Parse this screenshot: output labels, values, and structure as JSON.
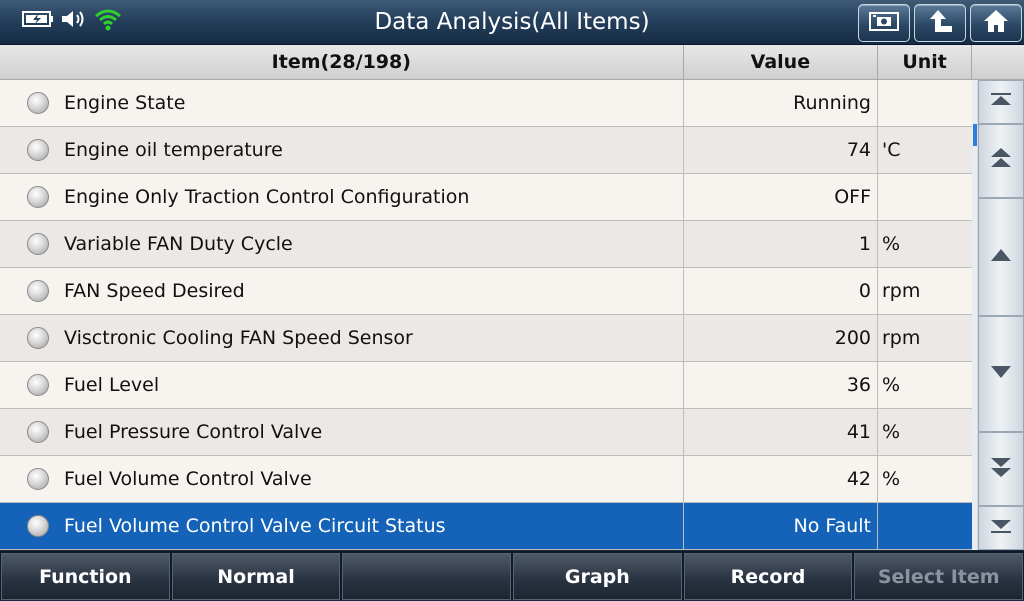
{
  "window": {
    "title": "Data Analysis(All Items)"
  },
  "status": {
    "battery_icon": "battery-charging-icon",
    "volume_icon": "volume-icon",
    "wifi_icon": "wifi-icon",
    "wifi_color": "#2fd12f"
  },
  "top_buttons": [
    {
      "name": "screenshot-icon"
    },
    {
      "name": "back-icon"
    },
    {
      "name": "home-icon"
    }
  ],
  "table": {
    "headers": {
      "item": "Item(28/198)",
      "value": "Value",
      "unit": "Unit"
    },
    "rows": [
      {
        "item": "Engine State",
        "value": "Running",
        "unit": ""
      },
      {
        "item": "Engine oil temperature",
        "value": "74",
        "unit": "'C"
      },
      {
        "item": "Engine Only Traction Control Configuration",
        "value": "OFF",
        "unit": ""
      },
      {
        "item": "Variable FAN Duty Cycle",
        "value": "1",
        "unit": "%"
      },
      {
        "item": "FAN Speed Desired",
        "value": "0",
        "unit": "rpm"
      },
      {
        "item": "Visctronic Cooling FAN Speed Sensor",
        "value": "200",
        "unit": "rpm"
      },
      {
        "item": "Fuel Level",
        "value": "36",
        "unit": "%"
      },
      {
        "item": "Fuel Pressure Control Valve",
        "value": "41",
        "unit": "%"
      },
      {
        "item": "Fuel Volume Control Valve",
        "value": "42",
        "unit": "%"
      },
      {
        "item": "Fuel Volume Control Valve Circuit Status",
        "value": "No Fault",
        "unit": ""
      }
    ],
    "selected_row": 9,
    "selected_color": "#1463b8"
  },
  "bottom_bar": {
    "function": "Function",
    "normal": "Normal",
    "empty": "",
    "graph": "Graph",
    "record": "Record",
    "select_item": "Select Item"
  }
}
